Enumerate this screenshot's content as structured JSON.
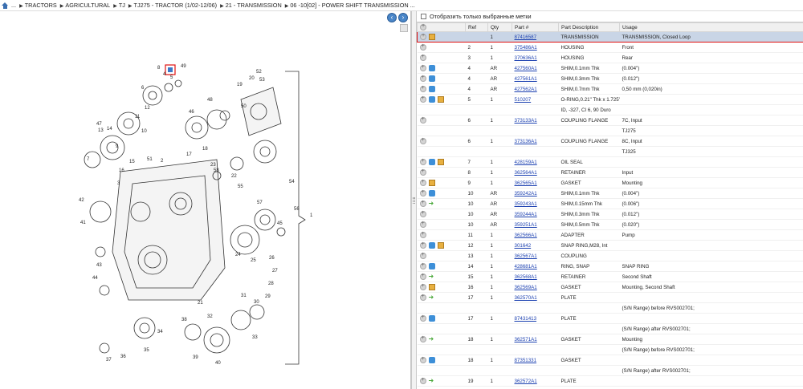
{
  "breadcrumb": {
    "items": [
      "...",
      "TRACTORS",
      "AGRICULTURAL",
      "TJ",
      "TJ275 - TRACTOR (1/02-12/06)",
      "21 - TRANSMISSION",
      "06 -10[02] - POWER SHIFT TRANSMISSION ..."
    ]
  },
  "filter": {
    "label": "Отобразить только выбранные метки"
  },
  "table": {
    "headers": [
      "Ref",
      "Qty",
      "Part #",
      "Part Description",
      "Usage"
    ],
    "rows": [
      {
        "ref": "",
        "qty": "1",
        "part": "87416587",
        "desc": "TRANSMISSION",
        "usage": "TRANSMISSION, Closed Loop",
        "icons": [
          "box"
        ],
        "sel": true
      },
      {
        "ref": "2",
        "qty": "1",
        "part": "375486A1",
        "desc": "HOUSING",
        "usage": "Front",
        "icons": []
      },
      {
        "ref": "3",
        "qty": "1",
        "part": "370636A1",
        "desc": "HOUSING",
        "usage": "Rear",
        "icons": []
      },
      {
        "ref": "4",
        "qty": "AR",
        "part": "427560A1",
        "desc": "SHIM,0.1mm Thk",
        "usage": "(0.004\")",
        "icons": [
          "info"
        ]
      },
      {
        "ref": "4",
        "qty": "AR",
        "part": "427561A1",
        "desc": "SHIM,0.3mm Thk",
        "usage": "(0.012\")",
        "icons": [
          "info"
        ]
      },
      {
        "ref": "4",
        "qty": "AR",
        "part": "427562A1",
        "desc": "SHIM,0.7mm Thk",
        "usage": "0,50 mm (0,020in)",
        "icons": [
          "info"
        ]
      },
      {
        "ref": "5",
        "qty": "1",
        "part": "510207",
        "desc": "O-RING,0.21\" Thk x 1.725\"",
        "usage": "",
        "icons": [
          "info",
          "box"
        ]
      },
      {
        "ref": "",
        "qty": "",
        "part": "",
        "desc": "ID, -327, CI 6, 90 Duro",
        "usage": "",
        "icons": [],
        "cont": true
      },
      {
        "ref": "6",
        "qty": "1",
        "part": "373133A1",
        "desc": "COUPLING FLANGE",
        "usage": "7C, Input",
        "icons": []
      },
      {
        "ref": "",
        "qty": "",
        "part": "",
        "desc": "",
        "usage": "TJ275",
        "icons": [],
        "cont": true
      },
      {
        "ref": "6",
        "qty": "1",
        "part": "373136A1",
        "desc": "COUPLING FLANGE",
        "usage": "8C, Input",
        "icons": []
      },
      {
        "ref": "",
        "qty": "",
        "part": "",
        "desc": "",
        "usage": "TJ325",
        "icons": [],
        "cont": true
      },
      {
        "ref": "7",
        "qty": "1",
        "part": "428159A1",
        "desc": "OIL SEAL",
        "usage": "",
        "icons": [
          "info",
          "box"
        ]
      },
      {
        "ref": "8",
        "qty": "1",
        "part": "362564A1",
        "desc": "RETAINER",
        "usage": "Input",
        "icons": []
      },
      {
        "ref": "9",
        "qty": "1",
        "part": "362565A1",
        "desc": "GASKET",
        "usage": "Mounting",
        "icons": [
          "box"
        ]
      },
      {
        "ref": "10",
        "qty": "AR",
        "part": "359242A1",
        "desc": "SHIM,0.1mm Thk",
        "usage": "(0.004\")",
        "icons": [
          "info"
        ]
      },
      {
        "ref": "10",
        "qty": "AR",
        "part": "359243A1",
        "desc": "SHIM,0.15mm Thk",
        "usage": "(0.006\")",
        "icons": [
          "arrow"
        ]
      },
      {
        "ref": "10",
        "qty": "AR",
        "part": "359244A1",
        "desc": "SHIM,0.3mm Thk",
        "usage": "(0.012\")",
        "icons": []
      },
      {
        "ref": "10",
        "qty": "AR",
        "part": "359251A1",
        "desc": "SHIM,0.5mm Thk",
        "usage": "(0.020\")",
        "icons": []
      },
      {
        "ref": "11",
        "qty": "1",
        "part": "362566A1",
        "desc": "ADAPTER",
        "usage": "Pump",
        "icons": []
      },
      {
        "ref": "12",
        "qty": "1",
        "part": "301642",
        "desc": "SNAP RING,M28, Int",
        "usage": "",
        "icons": [
          "info",
          "box"
        ]
      },
      {
        "ref": "13",
        "qty": "1",
        "part": "362567A1",
        "desc": "COUPLING",
        "usage": "",
        "icons": []
      },
      {
        "ref": "14",
        "qty": "1",
        "part": "428681A1",
        "desc": "RING, SNAP",
        "usage": "SNAP RING",
        "icons": [
          "info"
        ]
      },
      {
        "ref": "15",
        "qty": "1",
        "part": "362568A1",
        "desc": "RETAINER",
        "usage": "Second Shaft",
        "icons": [
          "arrow"
        ]
      },
      {
        "ref": "16",
        "qty": "1",
        "part": "362569A1",
        "desc": "GASKET",
        "usage": "Mounting, Second Shaft",
        "icons": [
          "box"
        ]
      },
      {
        "ref": "17",
        "qty": "1",
        "part": "362570A1",
        "desc": "PLATE",
        "usage": "",
        "icons": [
          "arrow"
        ]
      },
      {
        "ref": "",
        "qty": "",
        "part": "",
        "desc": "",
        "usage": "(S/N Range) before RVS002701;",
        "icons": [],
        "cont": true
      },
      {
        "ref": "17",
        "qty": "1",
        "part": "87431413",
        "desc": "PLATE",
        "usage": "",
        "icons": [
          "info"
        ]
      },
      {
        "ref": "",
        "qty": "",
        "part": "",
        "desc": "",
        "usage": "(S/N Range) after RVS002701;",
        "icons": [],
        "cont": true
      },
      {
        "ref": "18",
        "qty": "1",
        "part": "362571A1",
        "desc": "GASKET",
        "usage": "Mounting",
        "icons": [
          "arrow"
        ]
      },
      {
        "ref": "",
        "qty": "",
        "part": "",
        "desc": "",
        "usage": "(S/N Range) before RVS002701;",
        "icons": [],
        "cont": true
      },
      {
        "ref": "18",
        "qty": "1",
        "part": "87351331",
        "desc": "GASKET",
        "usage": "",
        "icons": [
          "info"
        ]
      },
      {
        "ref": "",
        "qty": "",
        "part": "",
        "desc": "",
        "usage": "(S/N Range) after RVS002701;",
        "icons": [],
        "cont": true
      },
      {
        "ref": "19",
        "qty": "1",
        "part": "362572A1",
        "desc": "PLATE",
        "usage": "",
        "icons": [
          "arrow"
        ]
      }
    ]
  },
  "diagram": {
    "callouts": [
      "49",
      "8",
      "5",
      "4",
      "6",
      "7",
      "9",
      "10",
      "11",
      "12",
      "13",
      "14",
      "15",
      "16",
      "17",
      "18",
      "19",
      "20",
      "47",
      "2",
      "3",
      "1",
      "42",
      "41",
      "43",
      "44",
      "45",
      "46",
      "48",
      "50",
      "51",
      "52",
      "53",
      "54",
      "55",
      "56",
      "57",
      "58",
      "22",
      "23",
      "24",
      "25",
      "26",
      "27",
      "28",
      "29",
      "30",
      "31",
      "32",
      "33",
      "34",
      "35",
      "36",
      "37",
      "38",
      "39",
      "40",
      "21"
    ]
  },
  "colors": {
    "accent": "#e01010",
    "selected_row": "#c9d5e6",
    "link": "#1a3fb0",
    "nav": "#4a86c8"
  }
}
